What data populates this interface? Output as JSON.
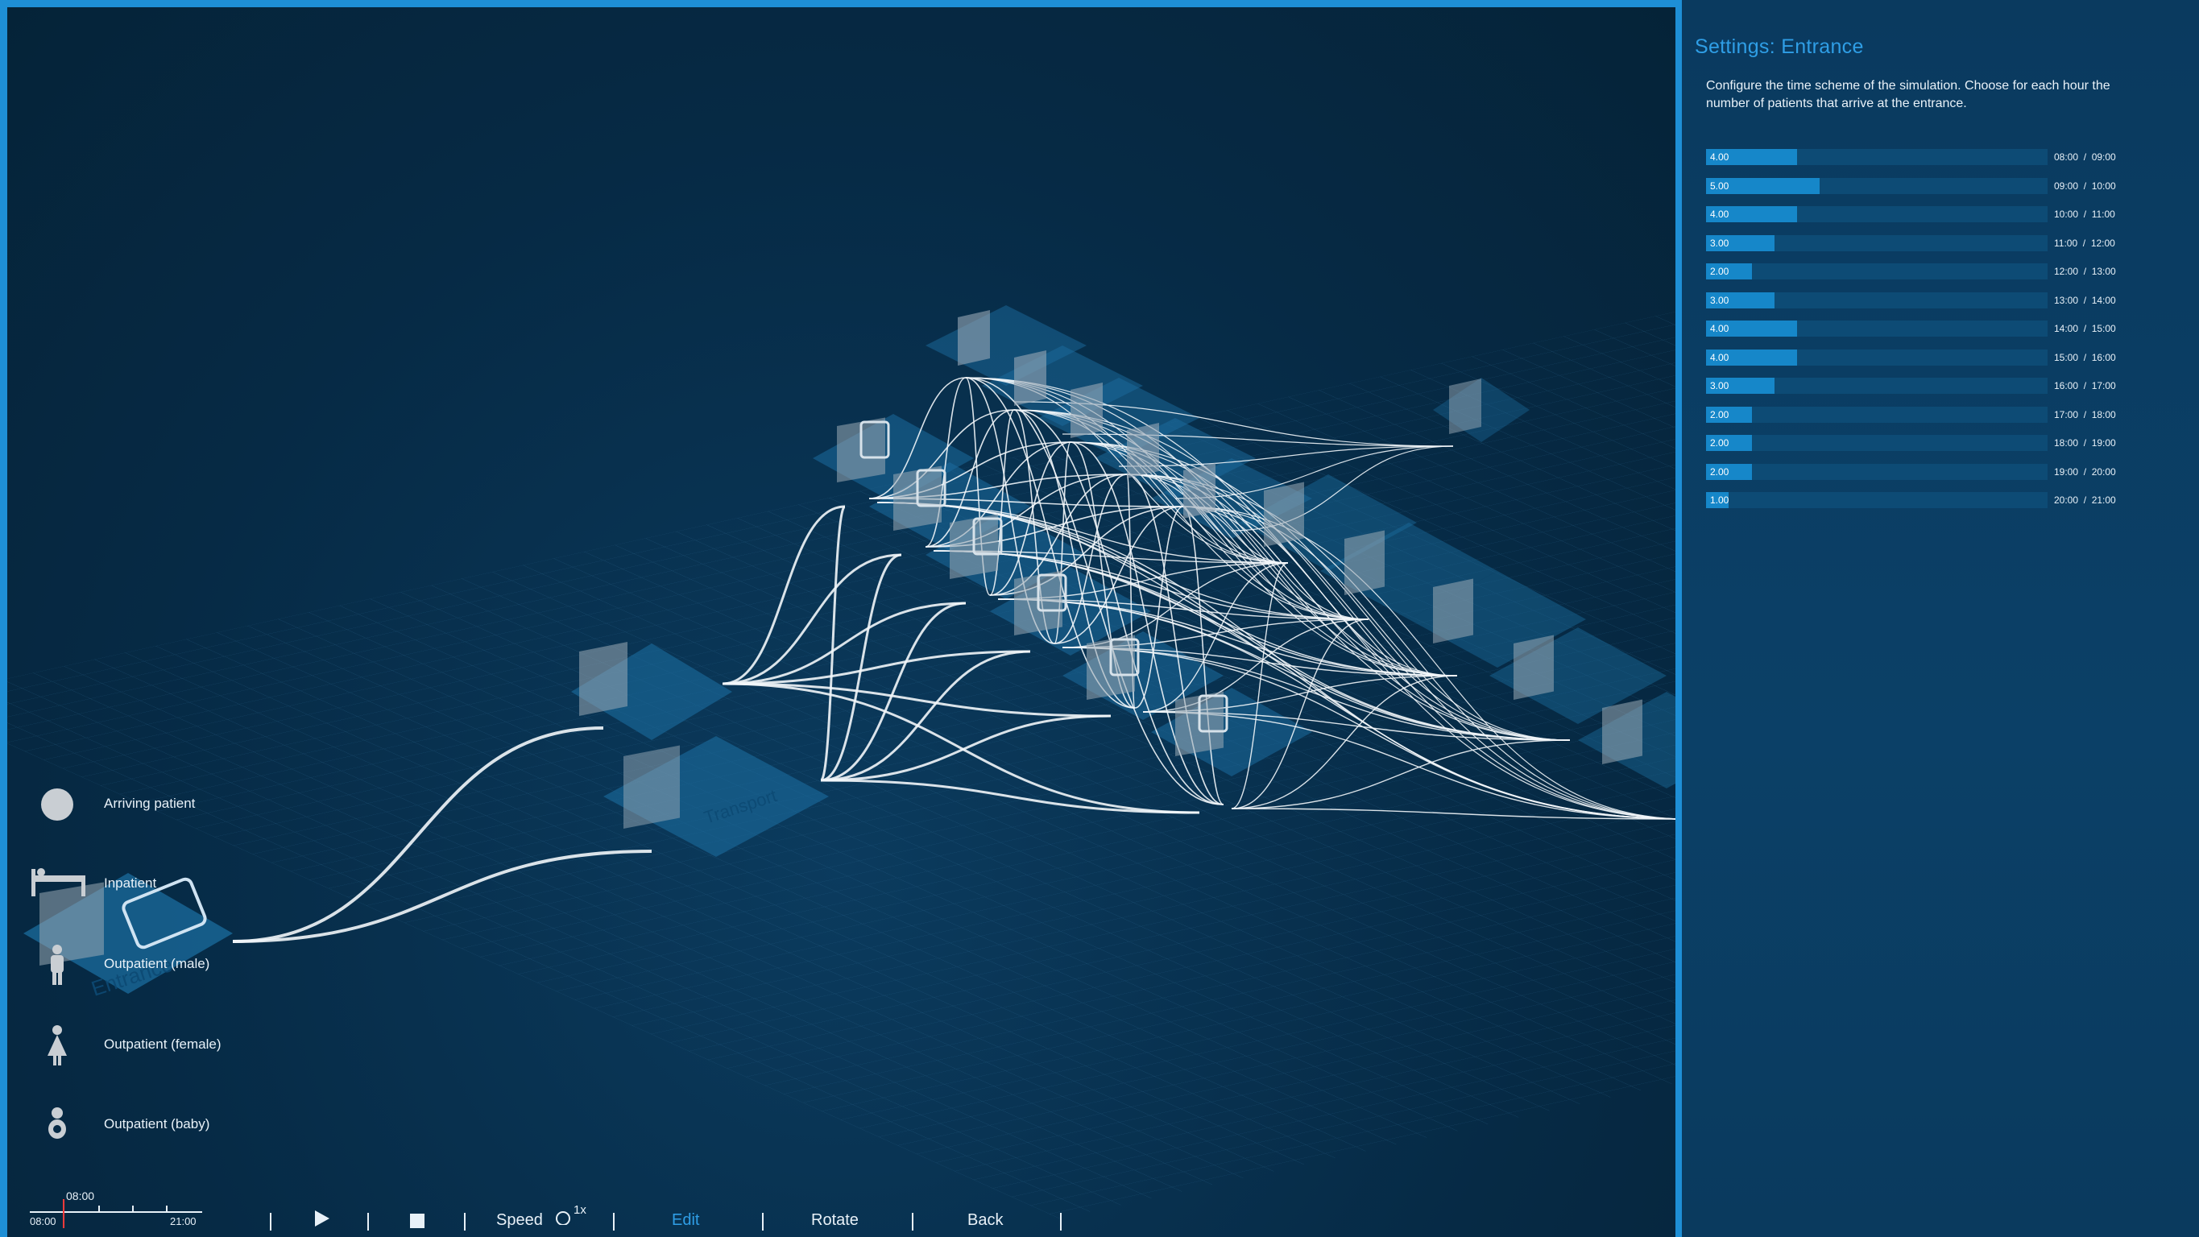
{
  "settings": {
    "title": "Settings: Entrance",
    "description": "Configure the time scheme of the simulation. Choose for each hour the number of patients that arrive at the entrance.",
    "max_patients": 15,
    "hours": [
      {
        "value": "4.00",
        "amount": 4,
        "from": "08:00",
        "to": "09:00"
      },
      {
        "value": "5.00",
        "amount": 5,
        "from": "09:00",
        "to": "10:00"
      },
      {
        "value": "4.00",
        "amount": 4,
        "from": "10:00",
        "to": "11:00"
      },
      {
        "value": "3.00",
        "amount": 3,
        "from": "11:00",
        "to": "12:00"
      },
      {
        "value": "2.00",
        "amount": 2,
        "from": "12:00",
        "to": "13:00"
      },
      {
        "value": "3.00",
        "amount": 3,
        "from": "13:00",
        "to": "14:00"
      },
      {
        "value": "4.00",
        "amount": 4,
        "from": "14:00",
        "to": "15:00"
      },
      {
        "value": "4.00",
        "amount": 4,
        "from": "15:00",
        "to": "16:00"
      },
      {
        "value": "3.00",
        "amount": 3,
        "from": "16:00",
        "to": "17:00"
      },
      {
        "value": "2.00",
        "amount": 2,
        "from": "17:00",
        "to": "18:00"
      },
      {
        "value": "2.00",
        "amount": 2,
        "from": "18:00",
        "to": "19:00"
      },
      {
        "value": "2.00",
        "amount": 2,
        "from": "19:00",
        "to": "20:00"
      },
      {
        "value": "1.00",
        "amount": 1,
        "from": "20:00",
        "to": "21:00"
      }
    ]
  },
  "legend": [
    {
      "label": "Arriving patient",
      "icon": "arriving-patient-icon"
    },
    {
      "label": "Inpatient",
      "icon": "inpatient-bed-icon"
    },
    {
      "label": "Outpatient (male)",
      "icon": "male-figure-icon"
    },
    {
      "label": "Outpatient (female)",
      "icon": "female-figure-icon"
    },
    {
      "label": "Outpatient (baby)",
      "icon": "baby-figure-icon"
    }
  ],
  "timeline": {
    "current": "08:00",
    "start": "08:00",
    "end": "21:00"
  },
  "controls": {
    "speed_label": "Speed",
    "speed_value": "1x",
    "edit_label": "Edit",
    "rotate_label": "Rotate",
    "back_label": "Back"
  },
  "scene": {
    "entrance_label": "Entrance",
    "transport_label": "Transport",
    "colors": {
      "accent": "#1e8fd6",
      "background": "#062a45",
      "flow_line": "#f2f6fa",
      "tile": "#1b6c9e"
    }
  }
}
